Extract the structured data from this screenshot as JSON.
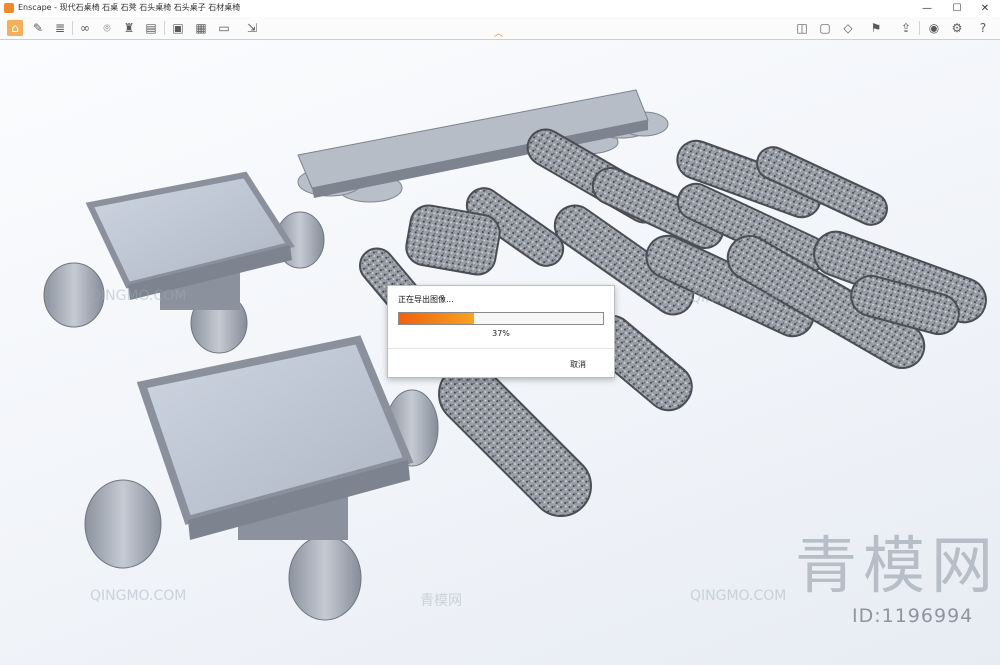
{
  "window": {
    "title": "Enscape - 现代石桌椅 石桌 石凳 石头桌椅 石头桌子 石材桌椅",
    "controls": {
      "minimize": "—",
      "maximize": "☐",
      "close": "✕"
    }
  },
  "toolbar": {
    "left_icons": [
      "home-icon",
      "views-icon",
      "list-icon",
      "binoculars-icon",
      "place-icon",
      "asset-icon",
      "building-icon",
      "clapper-icon",
      "screenshot-icon",
      "batch-render-icon",
      "video-editor-icon",
      "export-icon"
    ],
    "right_icons": [
      "map-icon",
      "panorama-icon",
      "cube-icon",
      "bookmark-icon",
      "upload-icon",
      "eye-icon",
      "settings-icon",
      "help-icon"
    ]
  },
  "watermarks": {
    "text_latin": "QINGMO.COM",
    "text_cn": "青模网",
    "big_brand": "青模网",
    "id_label": "ID:1196994"
  },
  "dialog": {
    "title": "正在导出图像...",
    "progress": 37,
    "progress_text": "37%",
    "cancel_label": "取消"
  },
  "colors": {
    "accent": "#f08a2a",
    "progress_start": "#f0610f",
    "progress_end": "#f7a320"
  }
}
